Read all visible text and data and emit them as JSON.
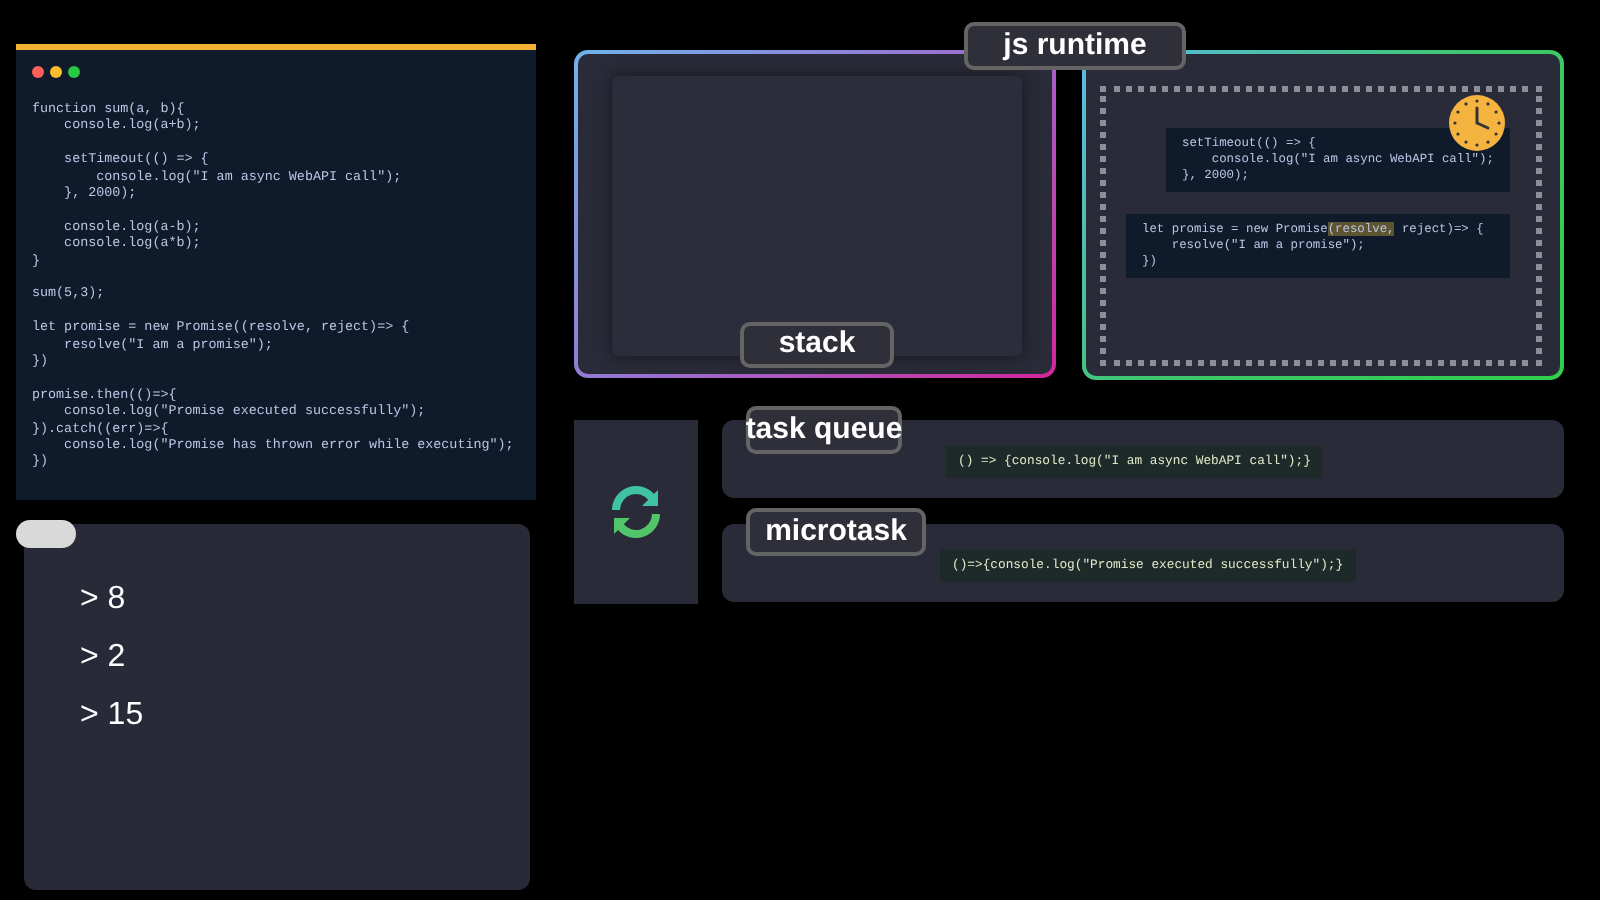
{
  "editor": {
    "code_blocks": [
      [
        "function sum(a, b){",
        "    console.log(a+b);"
      ],
      [
        "    setTimeout(() => {",
        "        console.log(\"I am async WebAPI call\");",
        "    }, 2000);"
      ],
      [
        "    console.log(a-b);",
        "    console.log(a*b);",
        "}"
      ],
      [
        "sum(5,3);"
      ],
      [
        "let promise = new Promise((resolve, reject)=> {",
        "    resolve(\"I am a promise\");",
        "})"
      ],
      [
        "promise.then(()=>{",
        "    console.log(\"Promise executed successfully\");",
        "}).catch((err)=>{",
        "    console.log(\"Promise has thrown error while executing\");",
        "})"
      ]
    ]
  },
  "console": {
    "lines": [
      "> 8",
      "> 2",
      "> 15"
    ]
  },
  "runtime": {
    "title": "js runtime",
    "stack": {
      "label": "stack"
    },
    "web_api": {
      "snippets": [
        {
          "lines": [
            [
              {
                "text": "setTimeout(() => {",
                "highlighted": false
              }
            ],
            [
              {
                "text": "    console.log(\"I am async WebAPI call\");",
                "highlighted": false
              }
            ],
            [
              {
                "text": "}, 2000);",
                "highlighted": false
              }
            ]
          ]
        },
        {
          "lines": [
            [
              {
                "text": "let promise = new Promise",
                "highlighted": false
              },
              {
                "text": "(resolve,",
                "highlighted": true
              },
              {
                "text": " reject)=> {",
                "highlighted": false
              }
            ],
            [
              {
                "text": "    resolve(\"I am a promise\");",
                "highlighted": false
              }
            ],
            [
              {
                "text": "})",
                "highlighted": false
              }
            ]
          ]
        }
      ]
    }
  },
  "queues": [
    {
      "label": "task queue",
      "item": "() => {console.log(\"I am async WebAPI call\");}"
    },
    {
      "label": "microtask",
      "item": "()=>{console.log(\"Promise executed successfully\");}"
    }
  ]
}
